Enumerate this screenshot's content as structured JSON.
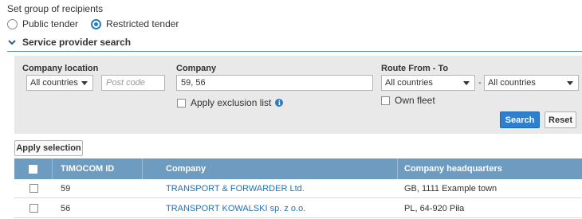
{
  "recipients": {
    "title": "Set group of recipients",
    "options": [
      {
        "label": "Public tender",
        "checked": false
      },
      {
        "label": "Restricted tender",
        "checked": true
      }
    ]
  },
  "section": {
    "title": "Service provider search",
    "icon": "chevron-down-icon"
  },
  "search": {
    "company_location_label": "Company location",
    "company_location_value": "All countries",
    "postcode_placeholder": "Post code",
    "company_label": "Company",
    "company_value": "59, 56",
    "apply_exclusion_label": "Apply exclusion list",
    "route_label": "Route From - To",
    "route_from_value": "All countries",
    "route_separator": "-",
    "route_to_value": "All countries",
    "own_fleet_label": "Own fleet",
    "search_button": "Search",
    "reset_button": "Reset"
  },
  "apply_selection": "Apply selection",
  "table": {
    "columns": [
      "TIMOCOM ID",
      "Company",
      "Company headquarters"
    ],
    "rows": [
      {
        "id": "59",
        "company": "TRANSPORT & FORWARDER Ltd.",
        "hq": "GB, 1111 Example town"
      },
      {
        "id": "56",
        "company": "TRANSPORT KOWALSKI sp. z o.o.",
        "hq": "PL, 64-920 Piła"
      }
    ]
  },
  "colors": {
    "accent": "#2b7bc0",
    "table_header": "#6e9bc0",
    "panel": "#e9e9e9",
    "link": "#2471b5"
  }
}
